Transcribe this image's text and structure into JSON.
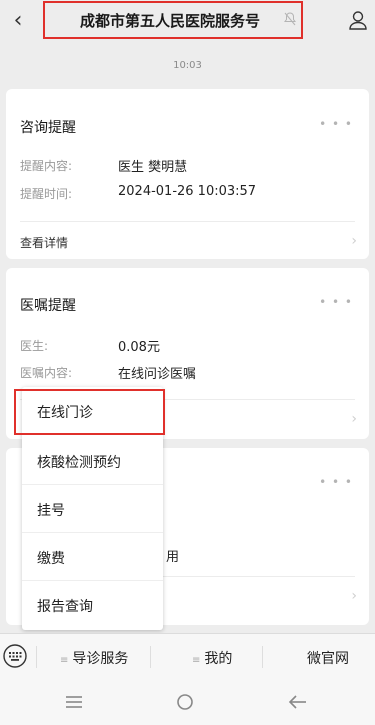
{
  "header": {
    "title": "成都市第五人民医院服务号"
  },
  "timestamp": "10:03",
  "consult_card": {
    "title": "咨询提醒",
    "rows": [
      {
        "label": "提醒内容:",
        "value": "医生 樊明慧"
      },
      {
        "label": "提醒时间:",
        "value": "2024-01-26 10:03:57"
      }
    ],
    "detail": "查看详情"
  },
  "advice_card": {
    "title": "医嘱提醒",
    "rows": [
      {
        "label": "医生:",
        "value": "0.08元"
      },
      {
        "label": "医嘱内容:",
        "value": "在线问诊医嘱"
      }
    ]
  },
  "third_card": {
    "partial_text": "用"
  },
  "popup_menu": {
    "items": [
      {
        "label": "在线门诊"
      },
      {
        "label": "核酸检测预约"
      },
      {
        "label": "挂号"
      },
      {
        "label": "缴费"
      },
      {
        "label": "报告查询"
      }
    ]
  },
  "bottom_menu": {
    "tabs": [
      {
        "label": "导诊服务"
      },
      {
        "label": "我的"
      },
      {
        "label": "微官网"
      }
    ]
  },
  "colors": {
    "highlight": "#e0302b",
    "background": "#ededed"
  },
  "icons": [
    "back-icon",
    "mute-icon",
    "profile-icon",
    "keyboard-icon",
    "menu-lines-icon",
    "home-circle-icon",
    "back-arrow-icon"
  ]
}
